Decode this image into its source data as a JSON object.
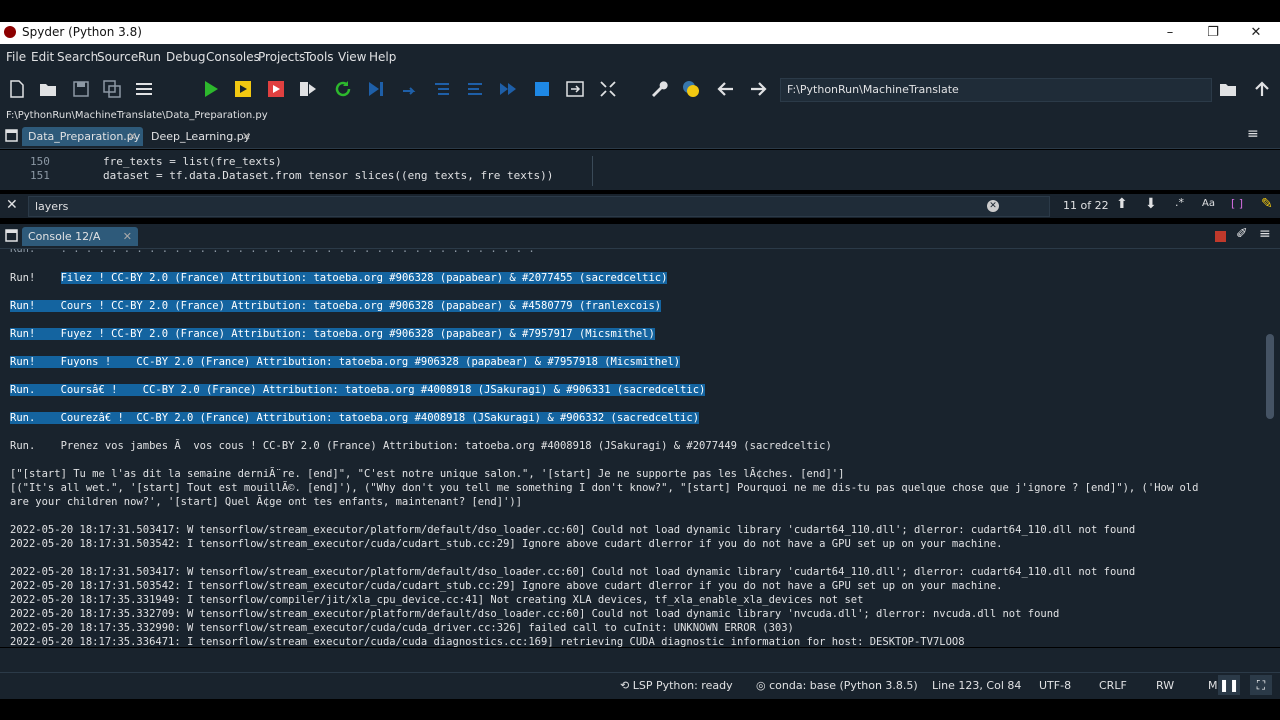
{
  "window": {
    "title": "Spyder (Python 3.8)",
    "minimize": "–",
    "restore": "❐",
    "close": "✕"
  },
  "menu": [
    "File",
    "Edit",
    "Search",
    "Source",
    "Run",
    "Debug",
    "Consoles",
    "Projects",
    "Tools",
    "View",
    "Help"
  ],
  "toolbar": {
    "working_dir": "F:\\PythonRun\\MachineTranslate"
  },
  "file_path": "F:\\PythonRun\\MachineTranslate\\Data_Preparation.py",
  "tabs": [
    {
      "label": "Data_Preparation.py",
      "close": "✕"
    },
    {
      "label": "Deep_Learning.py",
      "close": "✕"
    }
  ],
  "editor": {
    "lines": [
      {
        "num": "150",
        "code": "fre_texts = list(fre_texts)"
      },
      {
        "num": "151",
        "code": "dataset = tf.data.Dataset.from tensor slices((eng texts, fre texts))"
      }
    ]
  },
  "find": {
    "query": "layers",
    "count": "11 of 22"
  },
  "console_tab": {
    "label": "Console 12/A",
    "close": "✕"
  },
  "console": {
    "highlighted": [
      "Filez ! CC-BY 2.0 (France) Attribution: tatoeba.org #906328 (papabear) & #2077455 (sacredceltic)",
      "Run!    Cours ! CC-BY 2.0 (France) Attribution: tatoeba.org #906328 (papabear) & #4580779 (franlexcois)",
      "Run!    Fuyez ! CC-BY 2.0 (France) Attribution: tatoeba.org #906328 (papabear) & #7957917 (Micsmithel)",
      "Run!    Fuyons !    CC-BY 2.0 (France) Attribution: tatoeba.org #906328 (papabear) & #7957918 (Micsmithel)",
      "Run.    Coursâ€ !    CC-BY 2.0 (France) Attribution: tatoeba.org #4008918 (JSakuragi) & #906331 (sacredceltic)",
      "Run.    Courezâ€ !  CC-BY 2.0 (France) Attribution: tatoeba.org #4008918 (JSakuragi) & #906332 (sacredceltic)"
    ],
    "first_prefix": "Run!    ",
    "line7": "Run.    Prenez vos jambes Ã  vos cous ! CC-BY 2.0 (France) Attribution: tatoeba.org #4008918 (JSakuragi) & #2077449 (sacredceltic)",
    "line8": "[\"[start] Tu me l'as dit la semaine derniÃ¨re. [end]\", \"C'est notre unique salon.\", '[start] Je ne supporte pas les lÃ¢ches. [end]']",
    "line9": "[(\"It's all wet.\", '[start] Tout est mouillÃ©. [end]'), (\"Why don't you tell me something I don't know?\", \"[start] Pourquoi ne me dis-tu pas quelque chose que j'ignore ? [end]\"), ('How old",
    "line10": "are your children now?', '[start] Quel Ã¢ge ont tes enfants, maintenant? [end]')]",
    "log1": "2022-05-20 18:17:31.503417: W tensorflow/stream_executor/platform/default/dso_loader.cc:60] Could not load dynamic library 'cudart64_110.dll'; dlerror: cudart64_110.dll not found",
    "log2": "2022-05-20 18:17:31.503542: I tensorflow/stream_executor/cuda/cudart_stub.cc:29] Ignore above cudart dlerror if you do not have a GPU set up on your machine.",
    "log3": "2022-05-20 18:17:31.503417: W tensorflow/stream_executor/platform/default/dso_loader.cc:60] Could not load dynamic library 'cudart64_110.dll'; dlerror: cudart64_110.dll not found",
    "log4": "2022-05-20 18:17:31.503542: I tensorflow/stream_executor/cuda/cudart_stub.cc:29] Ignore above cudart dlerror if you do not have a GPU set up on your machine.",
    "log5": "2022-05-20 18:17:35.331949: I tensorflow/compiler/jit/xla_cpu_device.cc:41] Not creating XLA devices, tf_xla_enable_xla_devices not set",
    "log6": "2022-05-20 18:17:35.332709: W tensorflow/stream_executor/platform/default/dso_loader.cc:60] Could not load dynamic library 'nvcuda.dll'; dlerror: nvcuda.dll not found",
    "log7": "2022-05-20 18:17:35.332990: W tensorflow/stream_executor/cuda/cuda_driver.cc:326] failed call to cuInit: UNKNOWN ERROR (303)",
    "log8": "2022-05-20 18:17:35.336471: I tensorflow/stream_executor/cuda/cuda_diagnostics.cc:169] retrieving CUDA diagnostic information for host: DESKTOP-TV7LOO8"
  },
  "status": {
    "lsp": "LSP Python: ready",
    "conda": "conda: base (Python 3.8.5)",
    "position": "Line 123, Col 84",
    "encoding": "UTF-8",
    "eol": "CRLF",
    "permissions": "RW",
    "extra": "M"
  },
  "colors": {
    "background": "#19232d",
    "selection": "#1464a0",
    "run_green": "#2db82d",
    "stop_blue": "#1e88e5"
  }
}
